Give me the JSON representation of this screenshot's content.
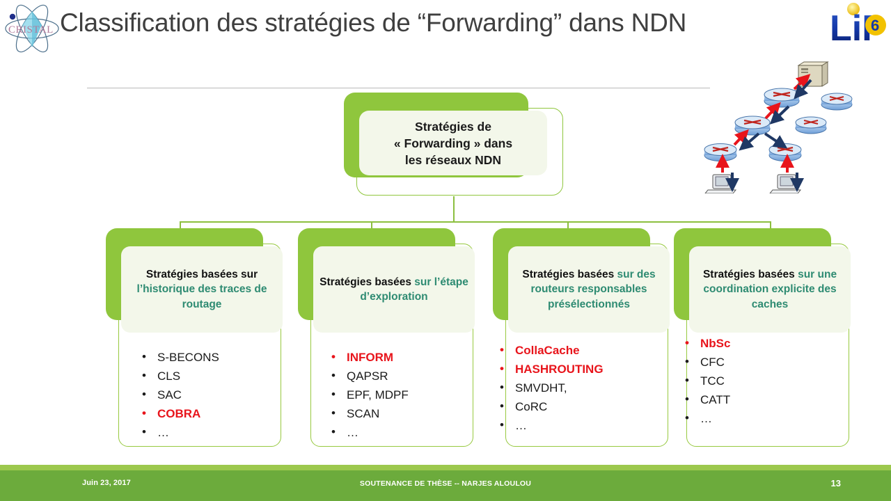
{
  "slide": {
    "title": "Classification des stratégies de “Forwarding” dans NDN",
    "accent_green": "#8fc63d",
    "panel_cream": "#f3f7ea",
    "head_green_text": "#2e8b72",
    "highlight_red": "#e8141b",
    "footer_green": "#6cab3c",
    "footer_stripe_green": "#9cc84d"
  },
  "logos": {
    "left": "cristal-logo",
    "right": "lip6-logo",
    "left_text": "CRISTAL",
    "right_text": "LiP",
    "right_badge": "6"
  },
  "root": {
    "line1": "Stratégies de",
    "line2": "« Forwarding » dans",
    "line3": "les réseaux NDN"
  },
  "columns": [
    {
      "head_black": "Stratégies basées sur",
      "head_green": "l’historique des traces de routage",
      "items": [
        {
          "label": "S-BECONS",
          "highlight": false
        },
        {
          "label": "CLS",
          "highlight": false
        },
        {
          "label": "SAC",
          "highlight": false
        },
        {
          "label": "COBRA",
          "highlight": true
        },
        {
          "label": "…",
          "highlight": false
        }
      ]
    },
    {
      "head_black": "Stratégies basées",
      "head_green": "sur l’étape d’exploration",
      "items": [
        {
          "label": "INFORM",
          "highlight": true
        },
        {
          "label": " QAPSR",
          "highlight": false
        },
        {
          "label": "EPF, MDPF",
          "highlight": false
        },
        {
          "label": "SCAN",
          "highlight": false
        },
        {
          "label": "…",
          "highlight": false
        }
      ]
    },
    {
      "head_black": "Stratégies basées",
      "head_green": "sur des routeurs responsables présélectionnés",
      "items": [
        {
          "label": "CollaCache",
          "highlight": true
        },
        {
          "label": "HASHROUTING",
          "highlight": true
        },
        {
          "label": "SMVDHT,",
          "highlight": false
        },
        {
          "label": "CoRC",
          "highlight": false
        },
        {
          "label": "…",
          "highlight": false
        }
      ]
    },
    {
      "head_black": "Stratégies basées",
      "head_green": "sur une coordination explicite des caches",
      "items": [
        {
          "label": "NbSc",
          "highlight": true
        },
        {
          "label": "CFC",
          "highlight": false
        },
        {
          "label": "TCC",
          "highlight": false
        },
        {
          "label": "CATT",
          "highlight": false
        },
        {
          "label": "…",
          "highlight": false
        }
      ]
    }
  ],
  "network_figure": {
    "name": "ndn-network-topology-illustration",
    "nodes": [
      "server",
      "router",
      "router",
      "router",
      "router",
      "router",
      "router",
      "pc",
      "pc"
    ],
    "interest_arrow_color": "#e8141b",
    "data_arrow_color": "#1f3864"
  },
  "footer": {
    "date": "Juin 23, 2017",
    "center": "SOUTENANCE DE THÈSE -- NARJES ALOULOU",
    "page": "13"
  }
}
